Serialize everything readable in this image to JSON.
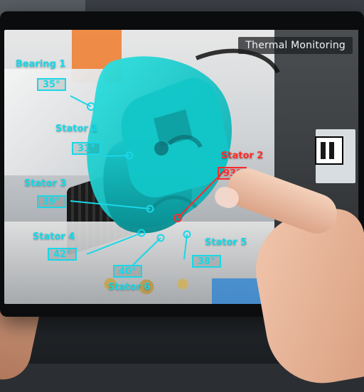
{
  "hud": {
    "title": "Thermal Monitoring"
  },
  "sensors": [
    {
      "name": "Bearing 1",
      "reading": "35°",
      "color": "#19d7e6"
    },
    {
      "name": "Stator 1",
      "reading": "31°",
      "color": "#19d7e6"
    },
    {
      "name": "Stator 2",
      "reading": "93°",
      "color": "#ff2b2b"
    },
    {
      "name": "Stator 3",
      "reading": "39°",
      "color": "#19d7e6"
    },
    {
      "name": "Stator 4",
      "reading": "42°",
      "color": "#19d7e6"
    },
    {
      "name": "Stator 5",
      "reading": "38°",
      "color": "#19d7e6"
    },
    {
      "name": "Stator 6",
      "reading": "40°",
      "color": "#19d7e6"
    }
  ],
  "colors": {
    "normal": "#19d7e6",
    "alert": "#ff2b2b"
  }
}
